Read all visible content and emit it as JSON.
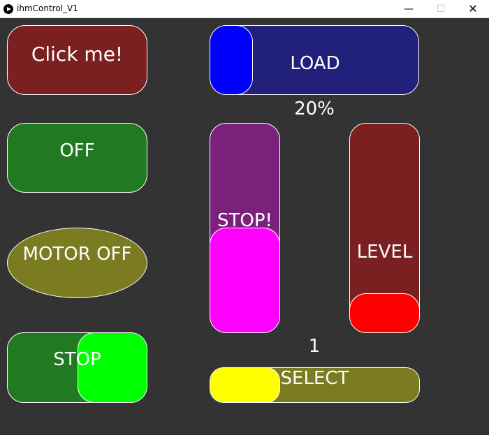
{
  "window": {
    "title": "ihmControl_V1",
    "minimize": "—",
    "maximize": "☐",
    "close": "✕"
  },
  "controls": {
    "click_button": {
      "label": "Click me!",
      "color": "#7b2020"
    },
    "off_button": {
      "label": "OFF",
      "color": "#217a21"
    },
    "motor_button": {
      "label": "MOTOR OFF",
      "color": "#7b7b21"
    },
    "stop_toggle": {
      "label": "STOP",
      "track_color": "#217a21",
      "knob_color": "#00ff00",
      "state": "on"
    },
    "load_slider": {
      "label": "LOAD",
      "value_text": "20%",
      "value": 0.2,
      "track_color": "#21217b",
      "knob_color": "#0000ff"
    },
    "stop_vslider": {
      "label": "STOP!",
      "level": 0.5,
      "track_color": "#7b217b",
      "knob_color": "#ff00ff"
    },
    "level_vslider": {
      "label": "LEVEL",
      "level": 0.19,
      "track_color": "#7b2020",
      "knob_color": "#ff0000"
    },
    "selector": {
      "label": "SELECT",
      "value_text": "1",
      "value": 1,
      "track_color": "#7b7b21",
      "knob_color": "#ffff00"
    }
  }
}
